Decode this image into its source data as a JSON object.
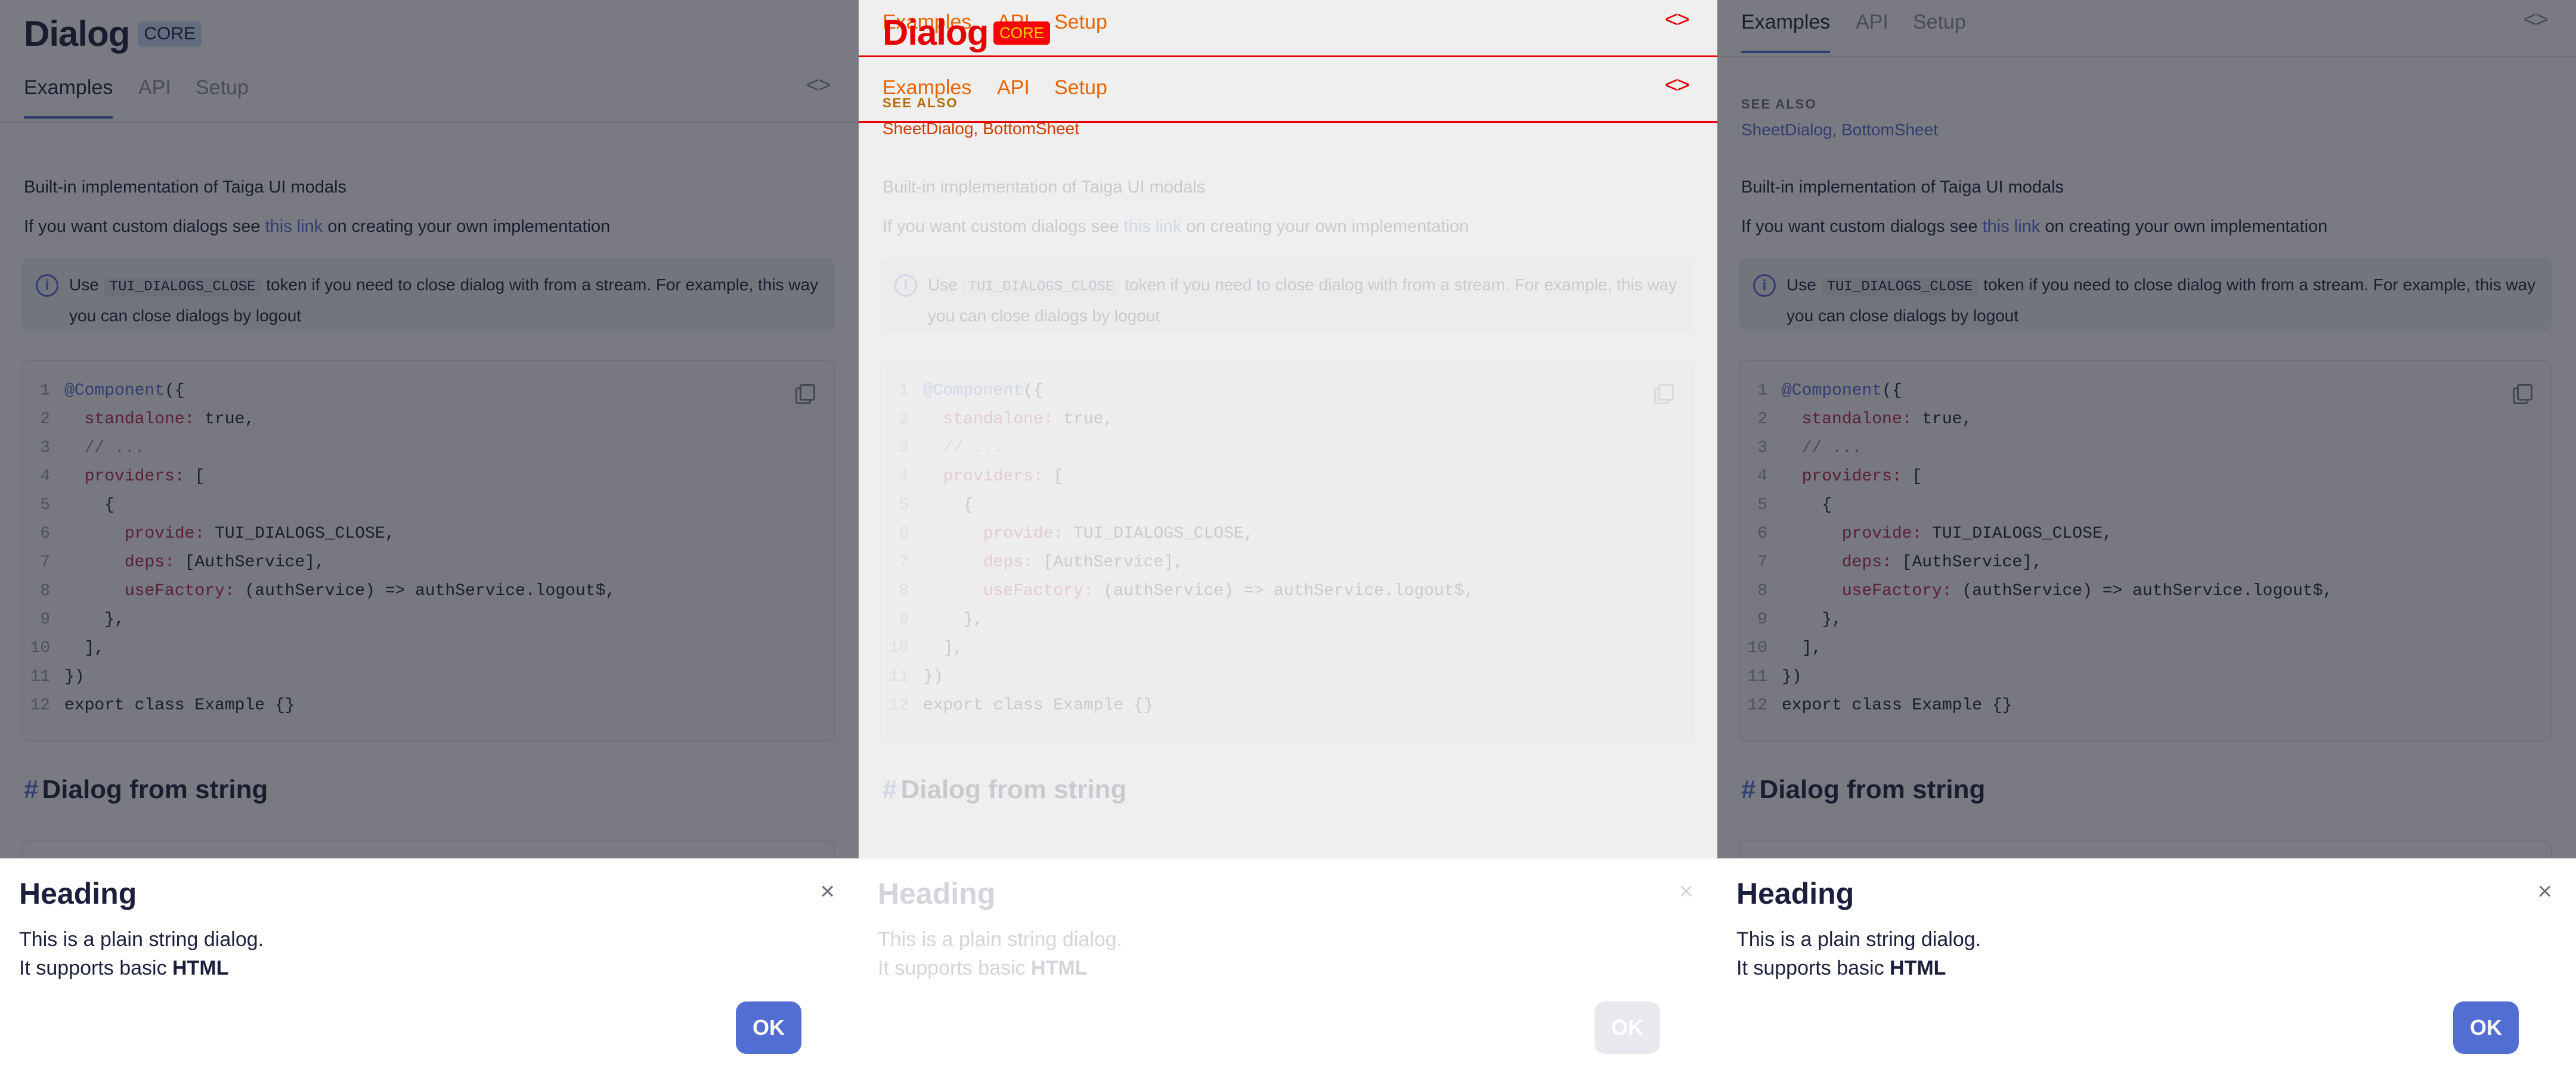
{
  "page": {
    "title": "Dialog",
    "badge": "CORE",
    "tabs": [
      "Examples",
      "API",
      "Setup"
    ],
    "code_toggle": "<>",
    "see_also": {
      "label": "SEE ALSO",
      "links": "SheetDialog, BottomSheet"
    },
    "description": "Built-in implementation of Taiga UI modals",
    "custom_prefix": "If you want custom dialogs see ",
    "custom_link": "this link",
    "custom_suffix": " on creating your own implementation",
    "notice": {
      "prefix": "Use ",
      "token": "TUI_DIALOGS_CLOSE",
      "suffix": " token if you need to close dialog with from a stream. For example, this way you can close dialogs by logout"
    },
    "code_lines": [
      "@Component({",
      "  standalone: true,",
      "  // ...",
      "  providers: [",
      "    {",
      "      provide: TUI_DIALOGS_CLOSE,",
      "      deps: [AuthService],",
      "      useFactory: (authService) => authService.logout$,",
      "    },",
      "  ],",
      "})",
      "export class Example {}"
    ],
    "section_hash": "#",
    "section_title": "Dialog from string"
  },
  "dialog": {
    "heading": "Heading",
    "line1": "This is a plain string dialog.",
    "line2_prefix": "It supports basic ",
    "line2_bold": "HTML",
    "close": "×",
    "ok_label": "OK"
  },
  "colors": {
    "accent": "#526ed3",
    "debug_red": "#e60000",
    "debug_orange": "#e86400"
  }
}
